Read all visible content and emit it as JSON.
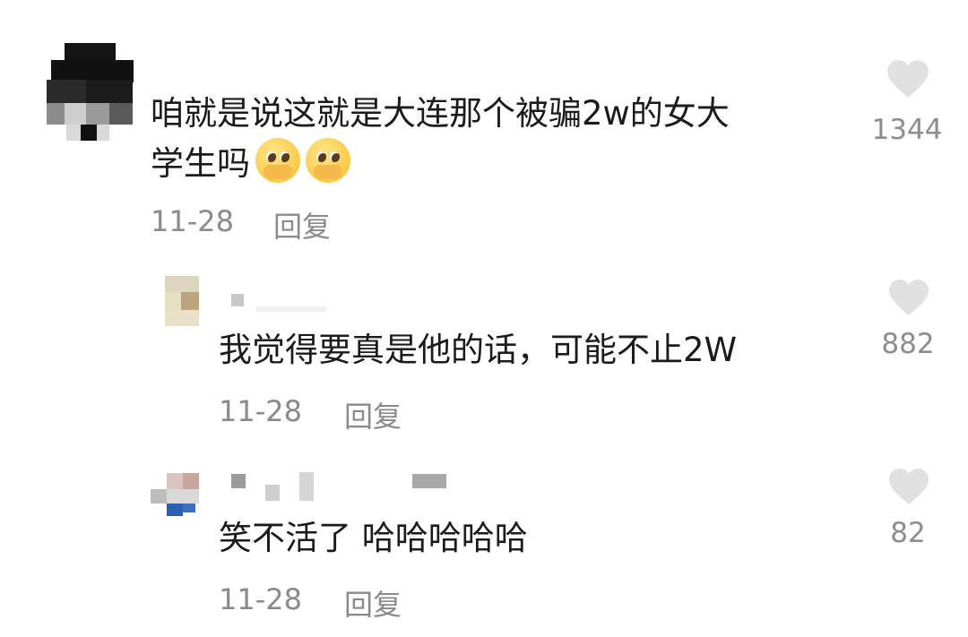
{
  "colors": {
    "background": "#ffffff",
    "text": "#1b1b1b",
    "meta": "#8a8a8a",
    "heart": "#e1e1e1"
  },
  "comments": [
    {
      "text_line1": "咱就是说这就是大连那个被骗2w的女大",
      "text_line2": "学生吗",
      "emojis": [
        "pleading-face-emoji",
        "pleading-face-emoji"
      ],
      "date": "11-28",
      "reply_label": "回复",
      "likes": "1344",
      "like_icon": "heart-icon"
    },
    {
      "text_line1": "我觉得要真是他的话，可能不止2W",
      "date": "11-28",
      "reply_label": "回复",
      "likes": "882",
      "like_icon": "heart-icon"
    },
    {
      "text_line1": "笑不活了 哈哈哈哈哈",
      "date": "11-28",
      "reply_label": "回复",
      "likes": "82",
      "like_icon": "heart-icon"
    }
  ]
}
